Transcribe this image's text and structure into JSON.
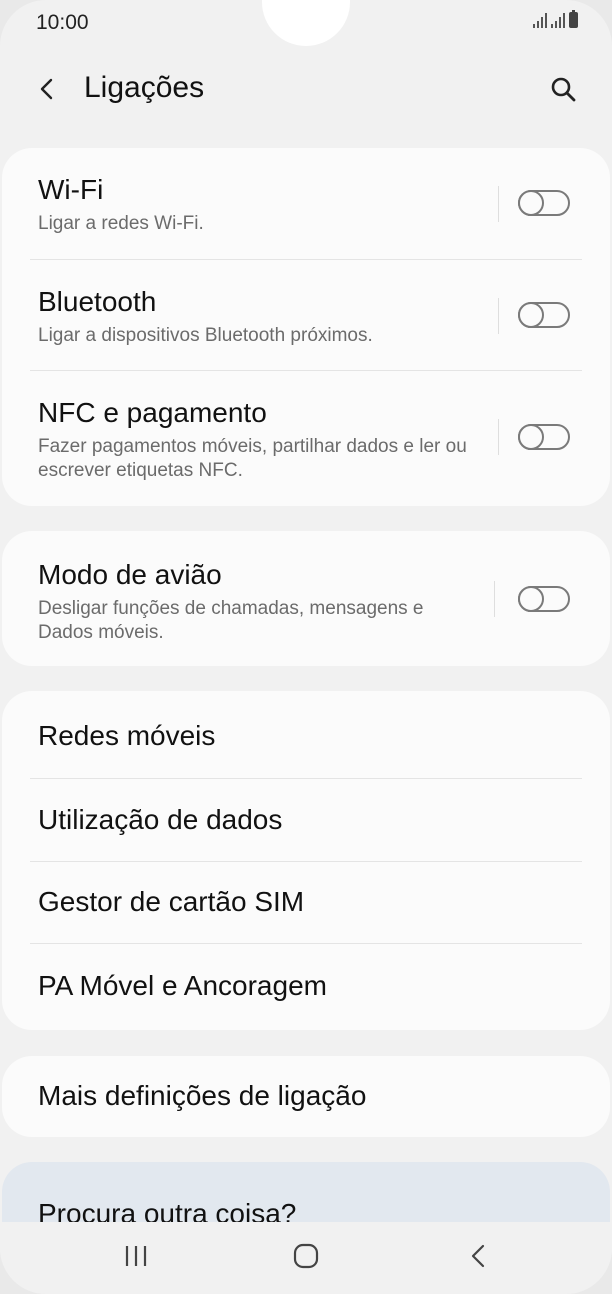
{
  "status_bar": {
    "time": "10:00"
  },
  "header": {
    "title": "Ligações"
  },
  "group1": [
    {
      "title": "Wi-Fi",
      "subtitle": "Ligar a redes Wi-Fi.",
      "enabled": false
    },
    {
      "title": "Bluetooth",
      "subtitle": "Ligar a dispositivos Bluetooth próximos.",
      "enabled": false
    },
    {
      "title": "NFC e pagamento",
      "subtitle": "Fazer pagamentos móveis, partilhar dados e ler ou escrever etiquetas NFC.",
      "enabled": false
    }
  ],
  "group2": [
    {
      "title": "Modo de avião",
      "subtitle": "Desligar funções de chamadas, mensagens e Dados móveis.",
      "enabled": false
    }
  ],
  "group3": [
    {
      "title": "Redes móveis"
    },
    {
      "title": "Utilização de dados"
    },
    {
      "title": "Gestor de cartão SIM"
    },
    {
      "title": "PA Móvel e Ancoragem"
    }
  ],
  "group4": [
    {
      "title": "Mais definições de ligação"
    }
  ],
  "hint": {
    "title": "Procura outra coisa?"
  },
  "nav": {
    "recent": "recent-apps-icon",
    "home": "home-icon",
    "back": "back-icon"
  }
}
